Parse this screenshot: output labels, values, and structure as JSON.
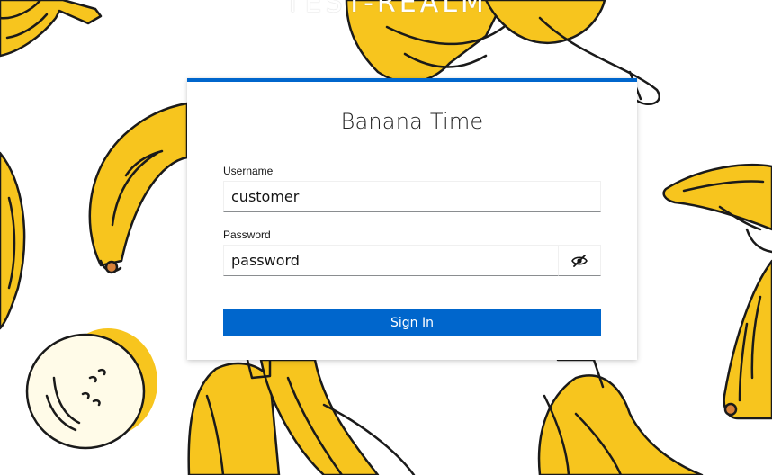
{
  "realm": {
    "title": "TEST-REALM"
  },
  "login": {
    "title": "Banana Time",
    "username_label": "Username",
    "username_value": "customer",
    "password_label": "Password",
    "password_value": "password",
    "show_password_icon": "eye-slash-icon",
    "signin_label": "Sign In"
  },
  "theme": {
    "accent": "#0066cc",
    "banana_yellow": "#f7c51e",
    "outline": "#1a1a1a"
  }
}
